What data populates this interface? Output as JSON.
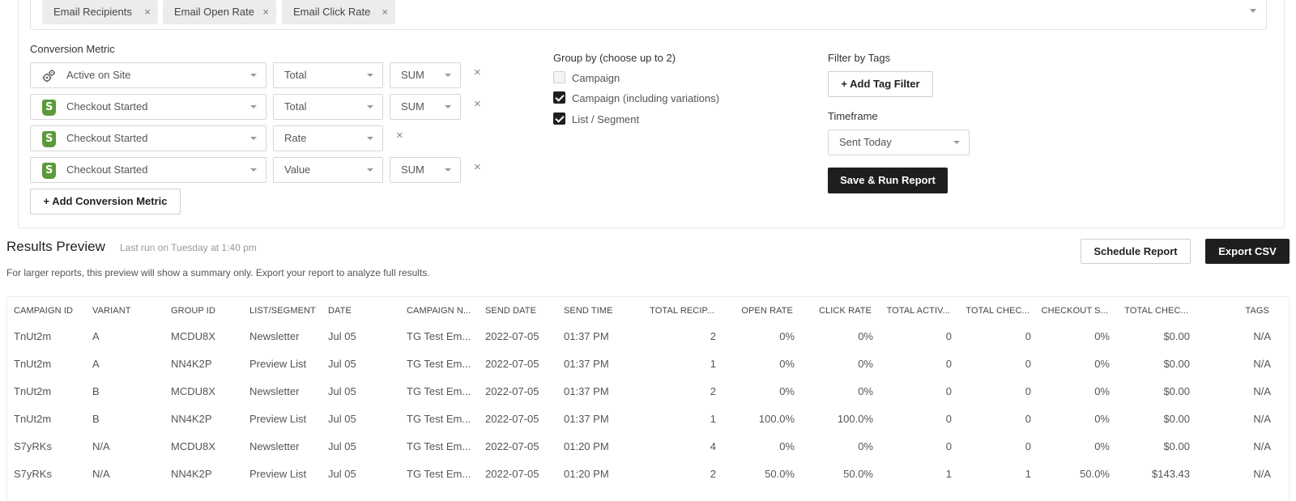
{
  "metric_chips": [
    {
      "label": "Email Recipients",
      "remove": "×"
    },
    {
      "label": "Email Open Rate",
      "remove": "×"
    },
    {
      "label": "Email Click Rate",
      "remove": "×"
    }
  ],
  "conversion": {
    "title": "Conversion Metric",
    "rows": [
      {
        "metric": "Active on Site",
        "icon": "gears-icon",
        "type": "Total",
        "agg": "SUM"
      },
      {
        "metric": "Checkout Started",
        "icon": "shopify-icon",
        "type": "Total",
        "agg": "SUM"
      },
      {
        "metric": "Checkout Started",
        "icon": "shopify-icon",
        "type": "Rate",
        "agg": null
      },
      {
        "metric": "Checkout Started",
        "icon": "shopify-icon",
        "type": "Value",
        "agg": "SUM"
      }
    ],
    "remove_symbol": "×",
    "add_label": "+ Add Conversion Metric"
  },
  "group_by": {
    "title": "Group by (choose up to 2)",
    "options": [
      {
        "label": "Campaign",
        "checked": false
      },
      {
        "label": "Campaign (including variations)",
        "checked": true
      },
      {
        "label": "List / Segment",
        "checked": true
      }
    ]
  },
  "filters": {
    "tags_title": "Filter by Tags",
    "add_tag_label": "+ Add Tag Filter",
    "timeframe_title": "Timeframe",
    "timeframe_value": "Sent Today",
    "save_run_label": "Save & Run Report"
  },
  "results": {
    "title": "Results Preview",
    "last_run": "Last run on Tuesday at 1:40 pm",
    "hint": "For larger reports, this preview will show a summary only. Export your report to analyze full results.",
    "schedule_label": "Schedule Report",
    "export_label": "Export CSV"
  },
  "table": {
    "columns": [
      "CAMPAIGN ID",
      "VARIANT",
      "GROUP ID",
      "LIST/SEGMENT",
      "DATE",
      "CAMPAIGN N...",
      "SEND DATE",
      "SEND TIME",
      "TOTAL RECIP...",
      "OPEN RATE",
      "CLICK RATE",
      "TOTAL ACTIV...",
      "TOTAL CHEC...",
      "CHECKOUT S...",
      "TOTAL CHEC...",
      "TAGS"
    ],
    "rows": [
      [
        "TnUt2m",
        "A",
        "MCDU8X",
        "Newsletter",
        "Jul 05",
        "TG Test Em...",
        "2022-07-05",
        "01:37 PM",
        "2",
        "0%",
        "0%",
        "0",
        "0",
        "0%",
        "$0.00",
        "N/A"
      ],
      [
        "TnUt2m",
        "A",
        "NN4K2P",
        "Preview List",
        "Jul 05",
        "TG Test Em...",
        "2022-07-05",
        "01:37 PM",
        "1",
        "0%",
        "0%",
        "0",
        "0",
        "0%",
        "$0.00",
        "N/A"
      ],
      [
        "TnUt2m",
        "B",
        "MCDU8X",
        "Newsletter",
        "Jul 05",
        "TG Test Em...",
        "2022-07-05",
        "01:37 PM",
        "2",
        "0%",
        "0%",
        "0",
        "0",
        "0%",
        "$0.00",
        "N/A"
      ],
      [
        "TnUt2m",
        "B",
        "NN4K2P",
        "Preview List",
        "Jul 05",
        "TG Test Em...",
        "2022-07-05",
        "01:37 PM",
        "1",
        "100.0%",
        "100.0%",
        "0",
        "0",
        "0%",
        "$0.00",
        "N/A"
      ],
      [
        "S7yRKs",
        "N/A",
        "MCDU8X",
        "Newsletter",
        "Jul 05",
        "TG Test Em...",
        "2022-07-05",
        "01:20 PM",
        "4",
        "0%",
        "0%",
        "0",
        "0",
        "0%",
        "$0.00",
        "N/A"
      ],
      [
        "S7yRKs",
        "N/A",
        "NN4K2P",
        "Preview List",
        "Jul 05",
        "TG Test Em...",
        "2022-07-05",
        "01:20 PM",
        "2",
        "50.0%",
        "50.0%",
        "1",
        "1",
        "50.0%",
        "$143.43",
        "N/A"
      ]
    ]
  }
}
